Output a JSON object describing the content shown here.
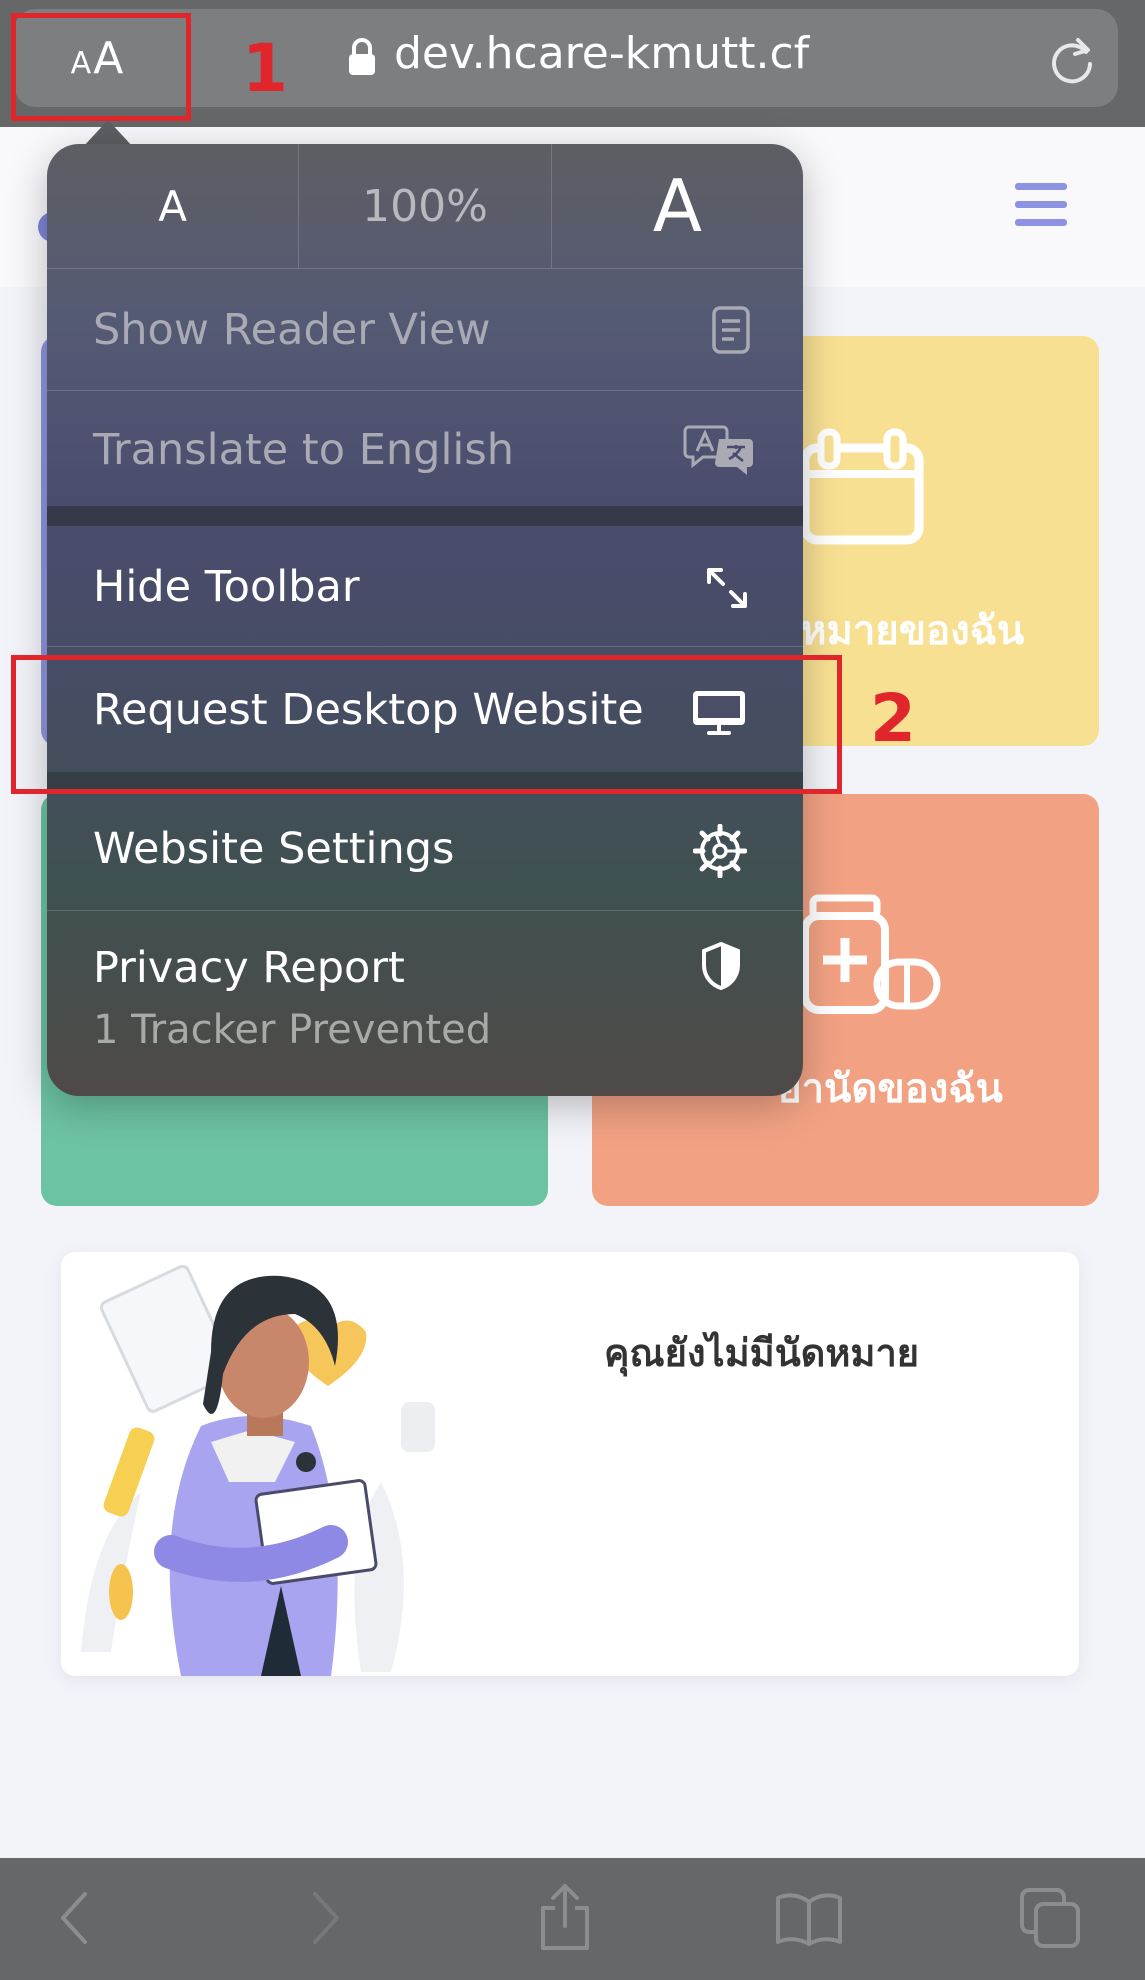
{
  "browser": {
    "text_size_button": {
      "small_a": "A",
      "large_a": "A"
    },
    "url": "dev.hcare-kmutt.cf"
  },
  "annotations": {
    "step1": "1",
    "step2": "2",
    "color": "#e0262b"
  },
  "popover": {
    "font_row": {
      "decrease": "A",
      "zoom": "100%",
      "increase": "A"
    },
    "items": [
      {
        "label": "Show Reader View",
        "icon": "reader-icon",
        "enabled": false
      },
      {
        "label": "Translate to English",
        "icon": "translate-icon",
        "enabled": false
      },
      {
        "label": "Hide Toolbar",
        "icon": "expand-arrows-icon",
        "enabled": true
      },
      {
        "label": "Request Desktop Website",
        "icon": "desktop-icon",
        "enabled": true
      },
      {
        "label": "Website Settings",
        "icon": "gear-icon",
        "enabled": true
      },
      {
        "label": "Privacy Report",
        "sublabel": "1 Tracker Prevented",
        "icon": "shield-icon",
        "enabled": true
      }
    ]
  },
  "page": {
    "cards": [
      {
        "label": "",
        "color": "#8f95df"
      },
      {
        "label": "นัดหมายของฉัน",
        "color": "#f8e093"
      },
      {
        "label": "",
        "color": "#6cc3a2"
      },
      {
        "label": "ยานัดของฉัน",
        "color": "#f2a283"
      }
    ],
    "appointment_empty": "คุณยังไม่มีนัดหมาย"
  },
  "colors": {
    "accent": "#8e92e3",
    "toolbar": "#666769"
  }
}
